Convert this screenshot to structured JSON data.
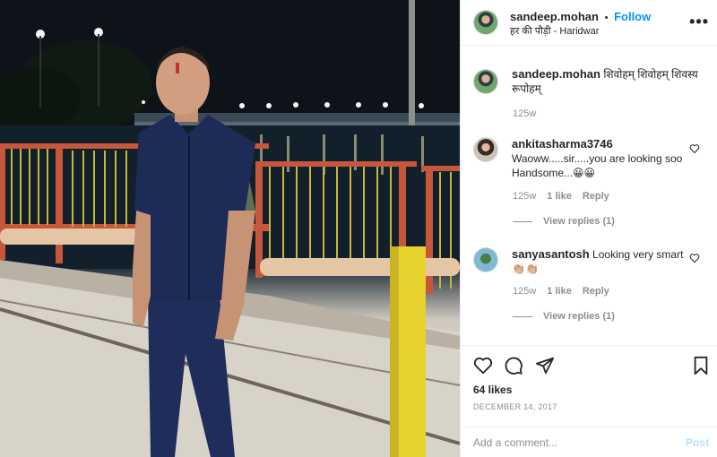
{
  "post": {
    "author": "sandeep.mohan",
    "separator": "•",
    "follow_label": "Follow",
    "location_prefix": "हर की पौड़ी",
    "location_sep": " - ",
    "location": "Haridwar",
    "more_icon": "more-horizontal-icon"
  },
  "caption": {
    "username": "sandeep.mohan",
    "text": "शिवोहम् शिवोहम् शिवस्य रूपोहम्",
    "age": "125w"
  },
  "comments": [
    {
      "username": "ankitasharma3746",
      "text": "Waoww.....sir.....you are looking soo Handsome...😀😀",
      "age": "125w",
      "likes": "1 like",
      "reply": "Reply",
      "view_replies": "View replies (1)"
    },
    {
      "username": "sanyasantosh",
      "text": "Looking very smart 👏🏼👏🏼",
      "age": "125w",
      "likes": "1 like",
      "reply": "Reply",
      "view_replies": "View replies (1)"
    }
  ],
  "actions": {
    "like_icon": "heart-icon",
    "comment_icon": "comment-icon",
    "share_icon": "share-icon",
    "save_icon": "bookmark-icon"
  },
  "likes_count": "64 likes",
  "date": "DECEMBER 14, 2017",
  "add_comment": {
    "placeholder": "Add a comment...",
    "post_label": "Post"
  },
  "colors": {
    "accent": "#0095f6",
    "muted": "#8e8e8e",
    "post_disabled": "#b2dffc"
  }
}
